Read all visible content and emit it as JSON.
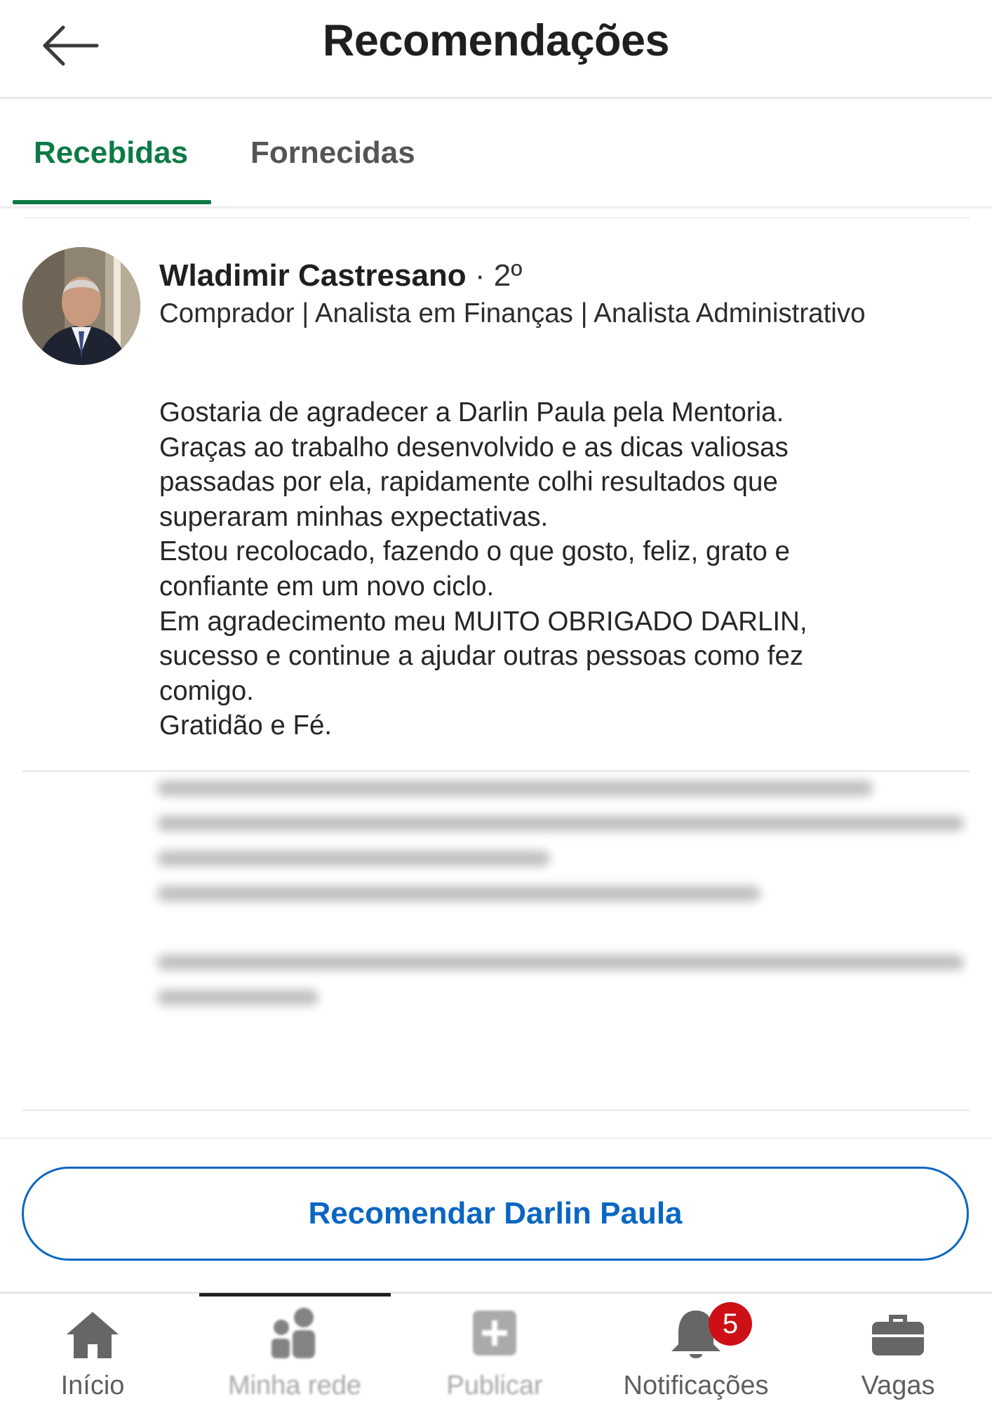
{
  "header": {
    "title": "Recomendações",
    "back_icon": "arrow-left-icon"
  },
  "tabs": [
    {
      "label": "Recebidas",
      "active": true
    },
    {
      "label": "Fornecidas",
      "active": false
    }
  ],
  "recommendation": {
    "name": "Wladimir Castresano",
    "degree": "· 2º",
    "headline": "Comprador | Analista em Finanças | Analista Administrativo",
    "body_lines": [
      "Gostaria de agradecer a Darlin Paula pela Mentoria.",
      "Graças ao trabalho desenvolvido e as dicas valiosas",
      "passadas por ela, rapidamente colhi resultados que",
      "superaram minhas expectativas.",
      "Estou recolocado, fazendo o que gosto, feliz, grato e",
      "confiante em um novo ciclo.",
      "Em agradecimento meu MUITO OBRIGADO DARLIN,",
      "sucesso e continue a ajudar outras pessoas como fez",
      "comigo.",
      "Gratidão e Fé."
    ]
  },
  "recommend_button": {
    "label": "Recomendar Darlin Paula"
  },
  "bottom_nav": [
    {
      "label": "Início",
      "icon": "home-icon"
    },
    {
      "label": "Minha rede",
      "icon": "network-icon"
    },
    {
      "label": "Publicar",
      "icon": "plus-square-icon"
    },
    {
      "label": "Notificações",
      "icon": "bell-icon",
      "badge": "5"
    },
    {
      "label": "Vagas",
      "icon": "briefcase-icon"
    }
  ],
  "colors": {
    "accent_green": "#0d7a45",
    "button_blue": "#0a66c2",
    "badge_red": "#cc1016"
  }
}
